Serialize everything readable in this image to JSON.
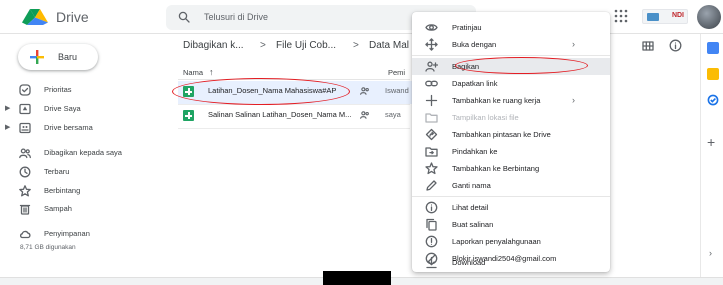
{
  "app": {
    "title": "Drive"
  },
  "search": {
    "placeholder": "Telusuri di Drive"
  },
  "header": {
    "brand_text": "NDI"
  },
  "sidebar": {
    "new_label": "Baru",
    "items": [
      {
        "label": "Prioritas"
      },
      {
        "label": "Drive Saya"
      },
      {
        "label": "Drive bersama"
      },
      {
        "label": "Dibagikan kepada saya"
      },
      {
        "label": "Terbaru"
      },
      {
        "label": "Berbintang"
      },
      {
        "label": "Sampah"
      },
      {
        "label": "Penyimpanan"
      }
    ],
    "storage_used": "8,71 GB digunakan"
  },
  "breadcrumb": {
    "items": [
      "Dibagikan k...",
      "File Uji Cob...",
      "Data Mal"
    ]
  },
  "file_list": {
    "headers": {
      "name": "Nama",
      "owner": "Pemi"
    },
    "rows": [
      {
        "name": "Latihan_Dosen_Nama Mahasiswa#AP",
        "owner": "Iswand"
      },
      {
        "name": "Salinan Salinan Latihan_Dosen_Nama M...",
        "owner": "saya"
      }
    ]
  },
  "context_menu": {
    "items": [
      {
        "label": "Pratinjau",
        "icon": "eye-icon"
      },
      {
        "label": "Buka dengan",
        "icon": "move-arrows-icon",
        "submenu": true
      },
      {
        "label": "Bagikan",
        "icon": "share-person-icon",
        "highlighted": true
      },
      {
        "label": "Dapatkan link",
        "icon": "link-icon"
      },
      {
        "label": "Tambahkan ke ruang kerja",
        "icon": "plus-icon",
        "submenu": true
      },
      {
        "label": "Tampilkan lokasi file",
        "icon": "folder-icon",
        "disabled": true
      },
      {
        "label": "Tambahkan pintasan ke Drive",
        "icon": "shortcut-icon"
      },
      {
        "label": "Pindahkan ke",
        "icon": "move-folder-icon"
      },
      {
        "label": "Tambahkan ke Berbintang",
        "icon": "star-icon"
      },
      {
        "label": "Ganti nama",
        "icon": "pencil-icon"
      },
      {
        "label": "Lihat detail",
        "icon": "info-icon"
      },
      {
        "label": "Buat salinan",
        "icon": "copy-icon"
      },
      {
        "label": "Laporkan penyalahgunaan",
        "icon": "report-icon"
      },
      {
        "label": "Blokir iswandi2504@gmail.com",
        "icon": "block-icon"
      },
      {
        "label": "Download",
        "icon": "download-icon"
      }
    ]
  },
  "colors": {
    "accent_blue": "#1a73e8",
    "annotation_red": "#e31e24",
    "sheets_green": "#1fa463",
    "menu_highlight": "#e8eaed"
  }
}
